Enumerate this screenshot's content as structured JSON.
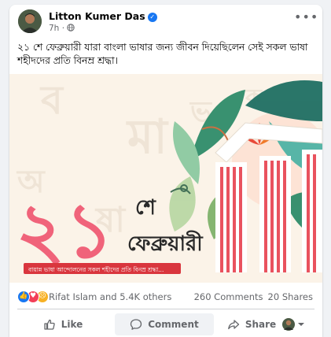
{
  "post": {
    "author": "Litton Kumer Das",
    "time": "7h",
    "meta_separator": "·",
    "text": "২১ শে ফেব্রুয়ারী যারা বাংলা ভাষার জন্য জীবন দিয়েছিলেন সেই সকল ভাষা শহীদদের প্রতি বিনম্র শ্রদ্ধা।"
  },
  "image": {
    "number": "২১",
    "title_line1": "শে",
    "title_line2": "ফেব্রুয়ারী",
    "banner": "বায়ান্ন ভাষা আন্দোলনের সকল শহীদের প্রতি বিনম্র শ্রদ্ধা..."
  },
  "stats": {
    "reactions_names": "Rifat Islam and 5.4K others",
    "comments": "260 Comments",
    "shares": "20 Shares"
  },
  "actions": {
    "like": "Like",
    "comment": "Comment",
    "share": "Share"
  },
  "colors": {
    "accent": "#1877f2",
    "number_red": "#f0637a",
    "pillar_red": "#e9525e",
    "banner_bg": "#d9363e"
  }
}
